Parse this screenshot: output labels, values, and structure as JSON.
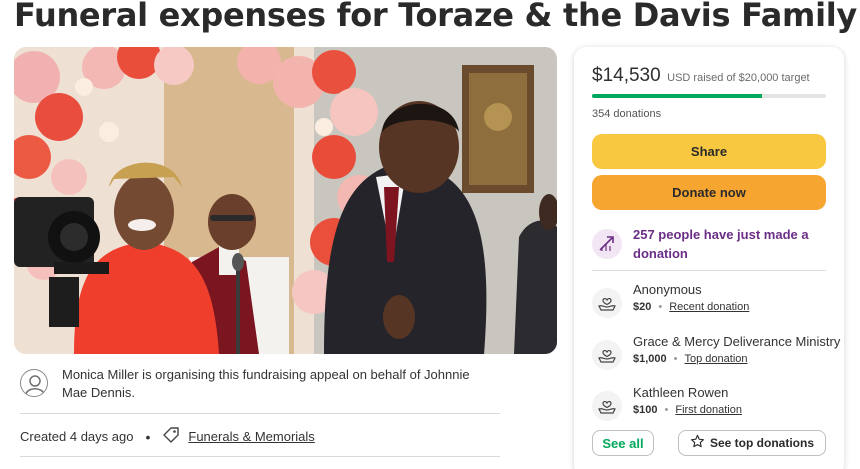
{
  "page": {
    "title": "Funeral expenses for Toraze & the Davis Family"
  },
  "organiser": {
    "text": "Monica Miller is organising this fundraising appeal on behalf of Johnnie Mae Dennis.",
    "created": "Created 4 days ago",
    "separator": "•",
    "category": "Funerals & Memorials"
  },
  "donation": {
    "raised_amount": "$14,530",
    "raised_sub": "USD raised of $20,000 target",
    "progress": 0.7265,
    "donations_count": "354 donations",
    "share_label": "Share",
    "donate_label": "Donate now",
    "trend_text": "257 people have just made a donation",
    "donors": [
      {
        "name": "Anonymous",
        "amount": "$20",
        "separator": "•",
        "kind": "Recent donation"
      },
      {
        "name": "Grace & Mercy Deliverance Ministry",
        "amount": "$1,000",
        "separator": "•",
        "kind": "Top donation"
      },
      {
        "name": "Kathleen Rowen",
        "amount": "$100",
        "separator": "•",
        "kind": "First donation"
      }
    ],
    "see_all_label": "See all",
    "see_top_label": "See top donations"
  },
  "icons": {
    "avatar": "user-avatar-icon",
    "tag": "tag-icon",
    "trend": "trending-up-icon",
    "donor": "hands-heart-icon",
    "star": "star-icon"
  },
  "colors": {
    "progress_green": "#02a95c",
    "share_yellow": "#f7c840",
    "donate_orange": "#f6a531",
    "trend_purple": "#6b2e86"
  }
}
